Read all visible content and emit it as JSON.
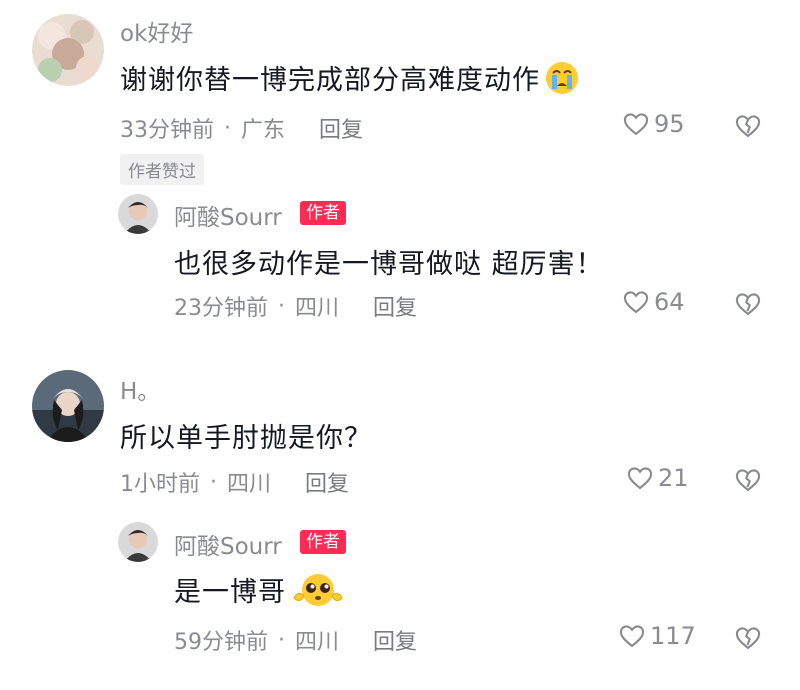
{
  "comments": [
    {
      "username": "ok好好",
      "text": "谢谢你替一博完成部分高难度动作",
      "emoji": "crying-face-emoji",
      "time": "33分钟前",
      "location": "广东",
      "reply_label": "回复",
      "likes": "95",
      "liked_by_author": "作者赞过",
      "replies": [
        {
          "username": "阿酸Sourr",
          "author_tag": "作者",
          "text": "也很多动作是一博哥做哒 超厉害！",
          "time": "23分钟前",
          "location": "四川",
          "reply_label": "回复",
          "likes": "64"
        }
      ]
    },
    {
      "username": "H。",
      "text": "所以单手肘抛是你？",
      "time": "1小时前",
      "location": "四川",
      "reply_label": "回复",
      "likes": "21",
      "replies": [
        {
          "username": "阿酸Sourr",
          "author_tag": "作者",
          "text": "是一博哥",
          "emoji": "pleading-face-emoji",
          "time": "59分钟前",
          "location": "四川",
          "reply_label": "回复",
          "likes": "117"
        }
      ]
    }
  ],
  "colors": {
    "background": "#ffffff",
    "text_primary": "#161823",
    "text_secondary": "#8a8b91",
    "author_tag_bg": "#fe2c55"
  }
}
